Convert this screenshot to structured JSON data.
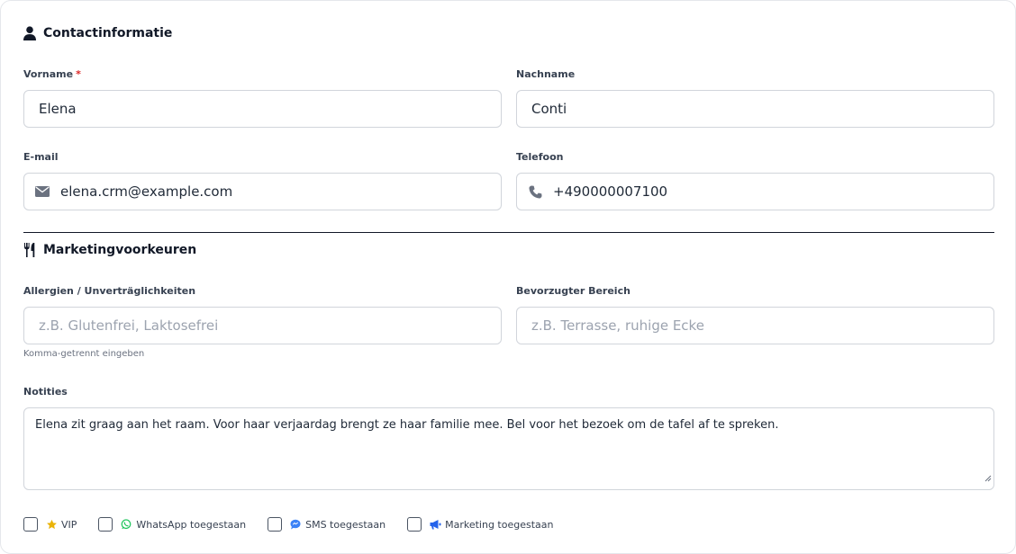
{
  "contact": {
    "title": "Contactinformatie",
    "first_name_label": "Vorname",
    "required_mark": "*",
    "first_name_value": "Elena",
    "last_name_label": "Nachname",
    "last_name_value": "Conti",
    "email_label": "E-mail",
    "email_value": "elena.crm@example.com",
    "phone_label": "Telefoon",
    "phone_value": "+490000007100"
  },
  "marketing": {
    "title": "Marketingvoorkeuren",
    "allergies_label": "Allergien / Unverträglichkeiten",
    "allergies_placeholder": "z.B. Glutenfrei, Laktosefrei",
    "allergies_help": "Komma-getrennt eingeben",
    "area_label": "Bevorzugter Bereich",
    "area_placeholder": "z.B. Terrasse, ruhige Ecke",
    "notes_label": "Notities",
    "notes_value": "Elena zit graag aan het raam. Voor haar verjaardag brengt ze haar familie mee. Bel voor het bezoek om de tafel af te spreken."
  },
  "checkboxes": [
    {
      "label": "VIP",
      "icon": "star-icon",
      "checked": false,
      "color": "#eab308"
    },
    {
      "label": "WhatsApp toegestaan",
      "icon": "whatsapp-icon",
      "checked": false,
      "color": "#22c55e"
    },
    {
      "label": "SMS toegestaan",
      "icon": "sms-chat-icon",
      "checked": false,
      "color": "#3b82f6"
    },
    {
      "label": "Marketing toegestaan",
      "icon": "megaphone-icon",
      "checked": false,
      "color": "#2563eb"
    }
  ]
}
